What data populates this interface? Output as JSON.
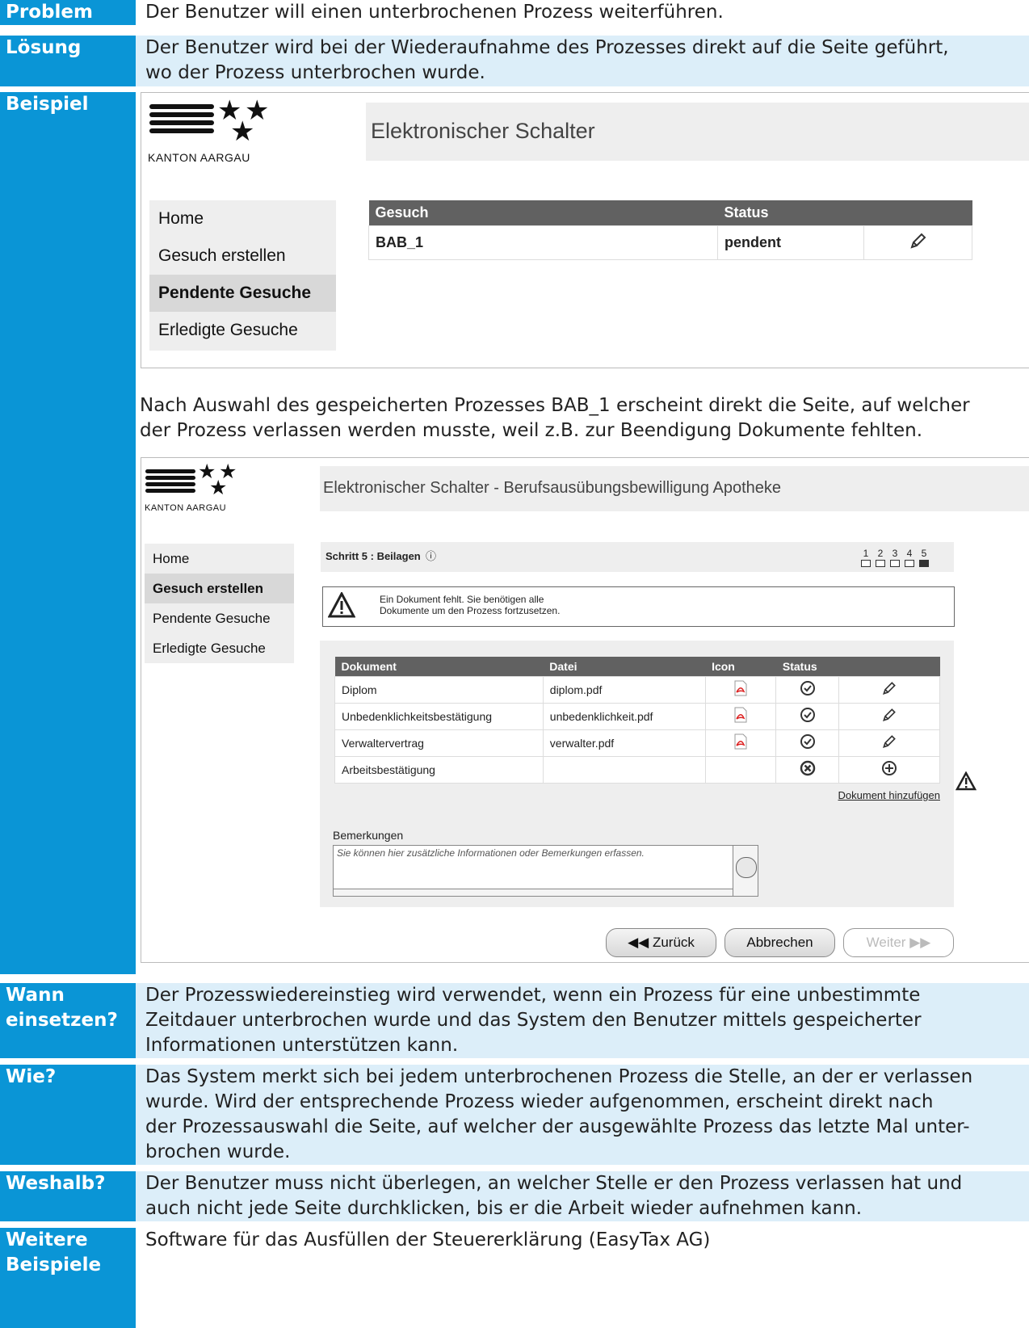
{
  "sections": {
    "problem": {
      "label": "Problem",
      "text": "Der Benutzer will einen unterbrochenen Prozess weiterführen."
    },
    "loesung": {
      "label": "Lösung",
      "line1": "Der Benutzer wird bei der Wiederaufnahme des Prozesses direkt auf die Seite geführt,",
      "line2": "wo der Prozess unterbrochen wurde."
    },
    "beispiel": {
      "label": "Beispiel",
      "caption1": "Nach Auswahl des gespeicherten Prozesses BAB_1 erscheint direkt die Seite, auf welcher",
      "caption2": "der Prozess verlassen werden musste, weil z.B. zur Beendigung Dokumente fehlten."
    },
    "wann": {
      "label1": "Wann",
      "label2": "einsetzen?",
      "line1": "Der Prozesswiedereinstieg wird verwendet, wenn ein Prozess für eine unbestimmte",
      "line2": "Zeitdauer unterbrochen wurde und das System den Benutzer mittels gespeicherter",
      "line3": "Informationen unterstützen kann."
    },
    "wie": {
      "label": "Wie?",
      "line1": "Das System merkt sich bei jedem unterbrochenen Prozess die Stelle, an der er verlassen",
      "line2": "wurde. Wird der entsprechende Prozess wieder aufgenommen, erscheint direkt nach",
      "line3": "der Prozessauswahl die Seite, auf welcher der ausgewählte Prozess das letzte Mal unter-",
      "line4": "brochen wurde."
    },
    "weshalb": {
      "label": "Weshalb?",
      "line1": "Der Benutzer muss nicht überlegen, an welcher Stelle er den Prozess verlassen hat und",
      "line2": "auch nicht jede Seite durchklicken, bis er die Arbeit wieder aufnehmen kann."
    },
    "weitere": {
      "label1": "Weitere",
      "label2": "Beispiele",
      "text": "Software für das Ausfüllen der Steuererklärung (EasyTax AG)"
    }
  },
  "mock1": {
    "logo_text": "KANTON AARGAU",
    "title": "Elektronischer Schalter",
    "nav": [
      "Home",
      "Gesuch erstellen",
      "Pendente Gesuche",
      "Erledigte Gesuche"
    ],
    "nav_active": "Pendente Gesuche",
    "table_headers": [
      "Gesuch",
      "Status",
      ""
    ],
    "table_rows": [
      {
        "gesuch": "BAB_1",
        "status": "pendent"
      }
    ]
  },
  "mock2": {
    "logo_text": "KANTON AARGAU",
    "title": "Elektronischer Schalter - Berufsausübungsbewilligung Apotheke",
    "nav": [
      "Home",
      "Gesuch erstellen",
      "Pendente Gesuche",
      "Erledigte Gesuche"
    ],
    "nav_active": "Gesuch erstellen",
    "step_label": "Schritt 5 : Beilagen",
    "steps": [
      "1",
      "2",
      "3",
      "4",
      "5"
    ],
    "current_step": 5,
    "warning_line1": "Ein Dokument fehlt. Sie benötigen alle",
    "warning_line2": "Dokumente um den Prozess fortzusetzen.",
    "doc_headers": [
      "Dokument",
      "Datei",
      "Icon",
      "Status",
      ""
    ],
    "docs": [
      {
        "name": "Diplom",
        "file": "diplom.pdf",
        "status": "ok"
      },
      {
        "name": "Unbedenklichkeitsbestätigung",
        "file": "unbedenklichkeit.pdf",
        "status": "ok"
      },
      {
        "name": "Verwaltervertrag",
        "file": "verwalter.pdf",
        "status": "ok"
      },
      {
        "name": "Arbeitsbestätigung",
        "file": "",
        "status": "missing"
      }
    ],
    "add_link": "Dokument hinzufügen",
    "remarks_label": "Bemerkungen",
    "remarks_placeholder": "Sie können hier zusätzliche Informationen oder Bemerkungen erfassen.",
    "btn_back": "◀◀ Zurück",
    "btn_cancel": "Abbrechen",
    "btn_next": "Weiter ▶▶"
  }
}
